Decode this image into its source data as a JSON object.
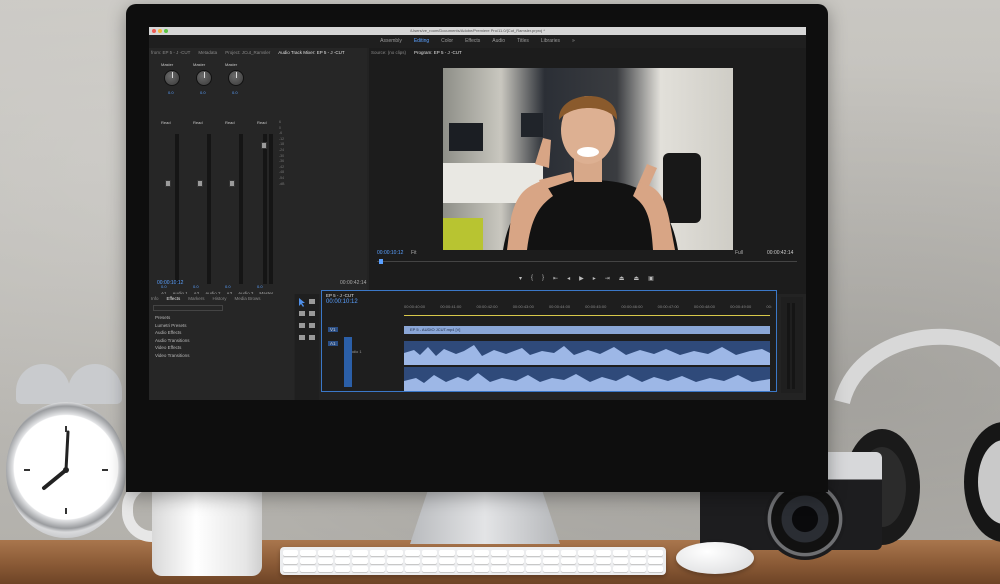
{
  "premiere": {
    "file_path": "/Users/ve_room/Documents/Adobe/Premiere Pro/11.0/[Cut_Ramsler.prproj *",
    "workspaces": [
      "Assembly",
      "Editing",
      "Color",
      "Effects",
      "Audio",
      "Titles",
      "Libraries",
      "»"
    ],
    "active_workspace": "Editing",
    "left_tabs": [
      "from: EP 5 - J -CUT",
      "Metadata",
      "Project: JCut_Ramsler",
      "Audio Track Mixer: EP 5 - J -CUT"
    ],
    "monitor_tabs": [
      "Source: (no clips)",
      "Program: EP 5 - J -CUT"
    ],
    "mixer": {
      "top_labels": [
        "Master",
        "Master",
        "Master"
      ],
      "knob_values": [
        "0.0",
        "0.0",
        "0.0"
      ],
      "read_labels": [
        "Read",
        "Read",
        "Read",
        "Read"
      ],
      "meter_values": [
        "0.0",
        "0.0",
        "0.0",
        "0.0"
      ],
      "track_names": [
        "A1",
        "Audio 1",
        "A2",
        "Audio 2",
        "A3",
        "Audio 3",
        "Master"
      ],
      "db_scale": [
        "6",
        "0",
        "-6",
        "-12",
        "-18",
        "-24",
        "-30",
        "-36",
        "-42",
        "-48",
        "-54",
        "-dB"
      ],
      "current_time": "00:00:10:12",
      "duration": "00:00:42:14"
    },
    "program": {
      "current_time": "00:00:10:12",
      "fit": "Fit",
      "quality": "Full",
      "duration": "00:00:42:14"
    },
    "effects_tabs": [
      "Info",
      "Effects",
      "Markers",
      "History",
      "Media Brows"
    ],
    "effects_list": [
      "Presets",
      "Lumetri Presets",
      "Audio Effects",
      "Audio Transitions",
      "Video Effects",
      "Video Transitions"
    ],
    "timeline": {
      "sequence_tab": "EP 5 - J -CUT",
      "current_time": "00:00:10:12",
      "ruler": [
        "00:00:40:00",
        "00:00:41:00",
        "00:00:42:00",
        "00:00:43:00",
        "00:00:44:00",
        "00:00:45:00",
        "00:00:46:00",
        "00:00:47:00",
        "00:00:48:00",
        "00:00:49:00",
        "00:"
      ],
      "clip_name": "EP 5 - AUDIO JCUT.mp4 [V]",
      "tracks": [
        "V1",
        "A1",
        "Audio 1"
      ]
    },
    "colors": {
      "accent": "#5aa0ff",
      "panel": "#232323",
      "clip": "#8aa6d6",
      "waveform": "#9db7e6"
    }
  }
}
